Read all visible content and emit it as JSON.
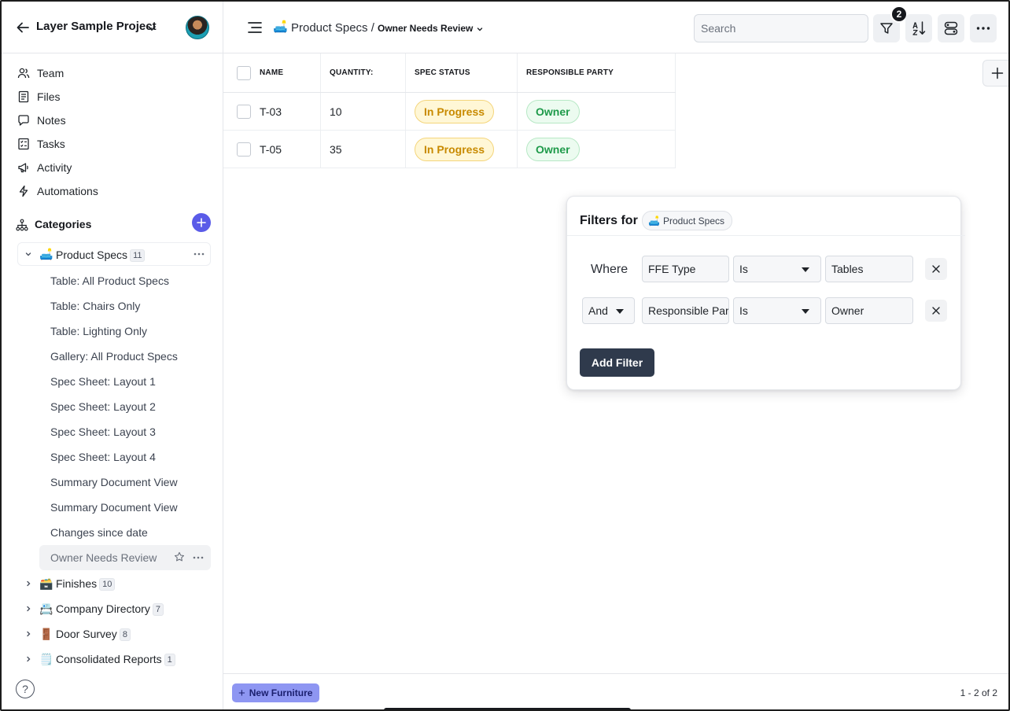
{
  "project": {
    "title": "Layer Sample Project"
  },
  "nav": [
    {
      "label": "Team",
      "icon": "team-icon"
    },
    {
      "label": "Files",
      "icon": "files-icon"
    },
    {
      "label": "Notes",
      "icon": "notes-icon"
    },
    {
      "label": "Tasks",
      "icon": "tasks-icon"
    },
    {
      "label": "Activity",
      "icon": "activity-icon"
    },
    {
      "label": "Automations",
      "icon": "automations-icon"
    }
  ],
  "categories_header": "Categories",
  "tree": {
    "root": {
      "emoji": "🛋️",
      "label": "Product Specs",
      "count": "11"
    },
    "views": [
      "Table: All Product Specs",
      "Table: Chairs Only",
      "Table: Lighting Only",
      "Gallery: All Product Specs",
      "Spec Sheet: Layout 1",
      "Spec Sheet: Layout 2",
      "Spec Sheet: Layout 3",
      "Spec Sheet: Layout 4",
      "Summary Document View",
      "Summary Document View",
      "Changes since date",
      "Owner Needs Review"
    ],
    "others": [
      {
        "emoji": "🗃️",
        "label": "Finishes",
        "count": "10"
      },
      {
        "emoji": "📇",
        "label": "Company Directory",
        "count": "7"
      },
      {
        "emoji": "🚪",
        "label": "Door Survey",
        "count": "8"
      },
      {
        "emoji": "🗒️",
        "label": "Consolidated Reports",
        "count": "1"
      }
    ]
  },
  "help_label": "?",
  "breadcrumb": {
    "emoji": "🛋️",
    "category": "Product Specs /",
    "view": "Owner Needs Review"
  },
  "search": {
    "placeholder": "Search",
    "value": ""
  },
  "toolbar": {
    "filter_count": "2"
  },
  "table": {
    "columns": [
      "NAME",
      "QUANTITY:",
      "SPEC STATUS",
      "RESPONSIBLE PARTY"
    ],
    "rows": [
      {
        "name": "T-03",
        "quantity": "10",
        "status": "In Progress",
        "party": "Owner"
      },
      {
        "name": "T-05",
        "quantity": "35",
        "status": "In Progress",
        "party": "Owner"
      }
    ]
  },
  "filters": {
    "title": "Filters for",
    "chip": {
      "emoji": "🛋️",
      "label": "Product Specs"
    },
    "rows": [
      {
        "conjunction": "Where",
        "field": "FFE Type",
        "operator": "Is",
        "value": "Tables"
      },
      {
        "conjunction": "And",
        "field": "Responsible Party",
        "operator": "Is",
        "value": "Owner"
      }
    ],
    "add_label": "Add Filter"
  },
  "footer": {
    "new_label": "New Furniture",
    "pager": "1 - 2 of 2"
  },
  "colors": {
    "accent": "#5a5be8",
    "progress": "#c88a00",
    "owner": "#1e9a4a",
    "dark_button": "#2f3a4c"
  }
}
